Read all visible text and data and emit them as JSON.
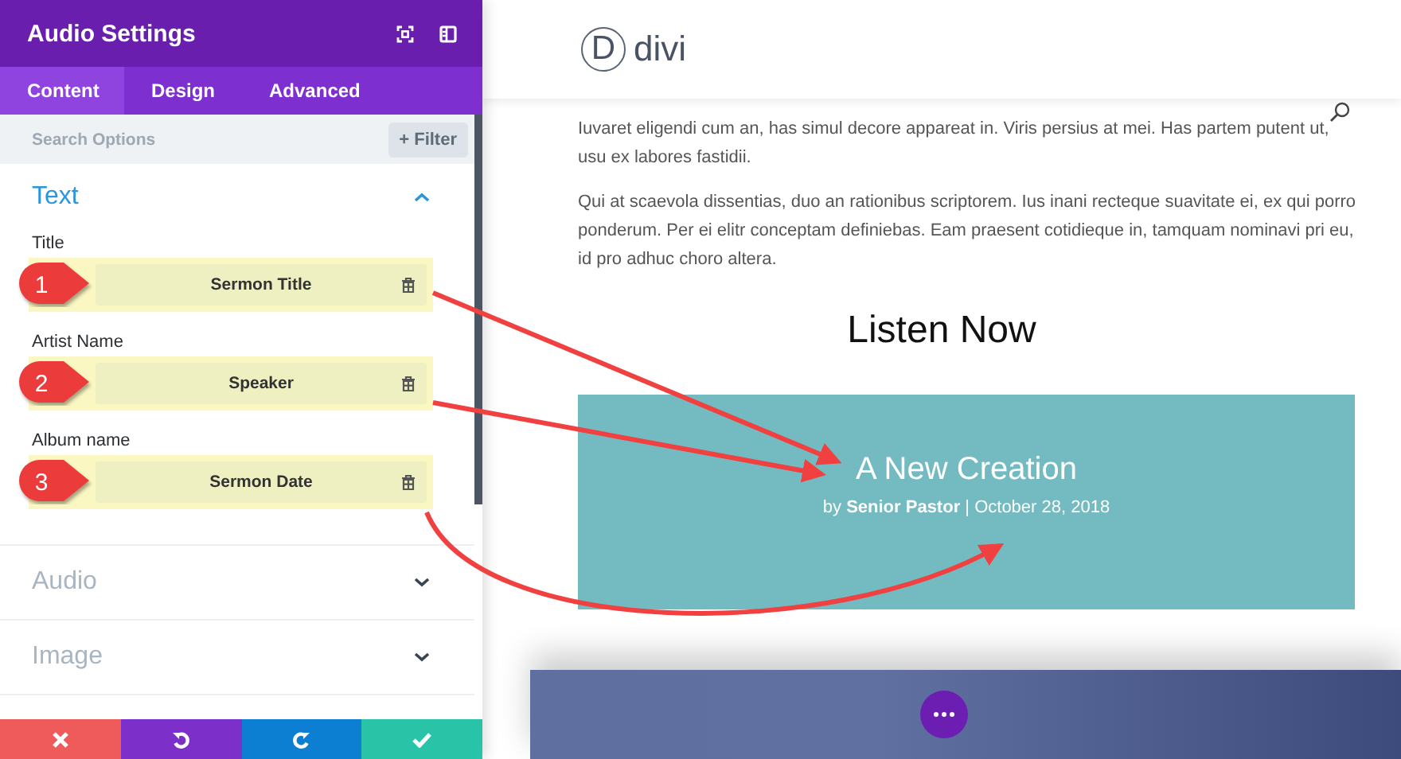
{
  "panel": {
    "title": "Audio Settings",
    "tabs": [
      {
        "label": "Content",
        "selected": true
      },
      {
        "label": "Design",
        "selected": false
      },
      {
        "label": "Advanced",
        "selected": false
      }
    ],
    "search": {
      "placeholder": "Search Options"
    },
    "filter_button": "+ Filter",
    "sections": [
      {
        "title": "Text",
        "expanded": true,
        "fields": [
          {
            "label": "Title",
            "value": "Sermon Title",
            "marker": "1"
          },
          {
            "label": "Artist Name",
            "value": "Speaker",
            "marker": "2"
          },
          {
            "label": "Album name",
            "value": "Sermon Date",
            "marker": "3"
          }
        ]
      },
      {
        "title": "Audio",
        "expanded": false
      },
      {
        "title": "Image",
        "expanded": false
      }
    ],
    "footer_buttons": [
      {
        "kind": "discard"
      },
      {
        "kind": "undo"
      },
      {
        "kind": "redo"
      },
      {
        "kind": "save"
      }
    ]
  },
  "page": {
    "logo_letter": "D",
    "logo_text": "divi",
    "paragraphs": [
      "Iuvaret eligendi cum an, has simul decore appareat in. Viris persius at mei. Has partem putent ut, usu ex labores fastidii.",
      "Qui at scaevola dissentias, duo an rationibus scriptorem. Ius inani recteque suavitate ei, ex qui porro ponderum. Per ei elitr conceptam definiebas. Eam praesent cotidieque in, tamquam nominavi pri eu, id pro adhuc choro altera."
    ],
    "heading": "Listen Now",
    "audio_card": {
      "title": "A New Creation",
      "meta": "by **Senior Pastor** | October 28, 2018"
    }
  }
}
